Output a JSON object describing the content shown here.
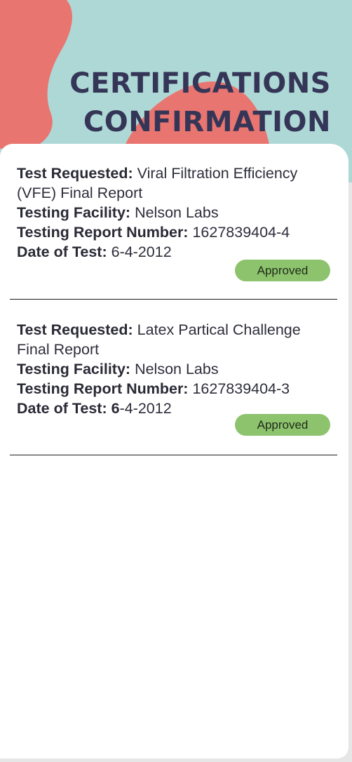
{
  "header": {
    "title_line_1": "CERTIFICATIONS",
    "title_line_2": "CONFIRMATION"
  },
  "colors": {
    "title": "#353657",
    "teal_background": "#aed8d6",
    "coral_blob": "#e97570",
    "approved_badge": "#8dc36d"
  },
  "certifications": [
    {
      "test_requested_label": "Test Requested:",
      "test_requested": "Viral Filtration Efficiency (VFE) Final Report",
      "facility_label": "Testing Facility:",
      "facility": "Nelson Labs",
      "report_number_label": "Testing Report Number:",
      "report_number": "1627839404-4",
      "date_label": "Date of Test:",
      "date": "6-4-2012",
      "status": "Approved"
    },
    {
      "test_requested_label": "Test Requested:",
      "test_requested": "Latex Partical Challenge Final Report",
      "facility_label": "Testing Facility:",
      "facility": "Nelson Labs",
      "report_number_label": "Testing Report Number:",
      "report_number": "1627839404-3",
      "date_label": "Date of Test:",
      "date_bold_part": "6",
      "date_rest": "-4-2012",
      "status": "Approved"
    }
  ]
}
